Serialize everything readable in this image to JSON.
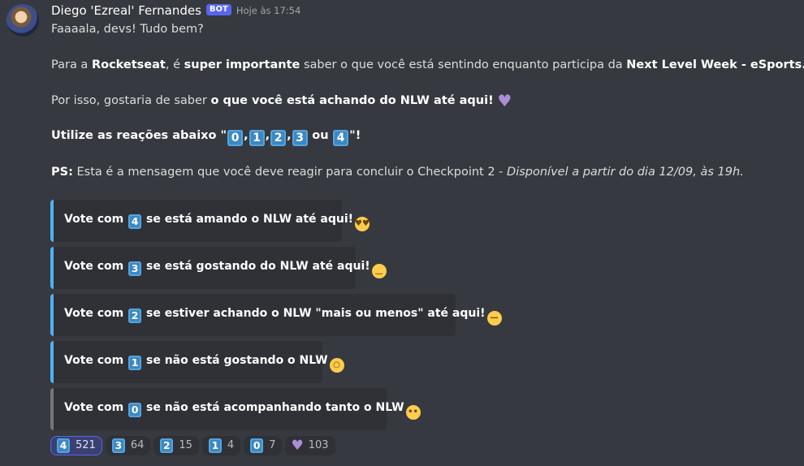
{
  "author": {
    "name": "Diego 'Ezreal' Fernandes",
    "tag": "BOT",
    "timestamp": "Hoje às 17:54"
  },
  "message": {
    "greeting": "Faaaala, devs! Tudo bem?",
    "para2": {
      "a": "Para a ",
      "b1": "Rocketseat",
      "c": ", é ",
      "b2": "super importante",
      "d": " saber o que você está sentindo enquanto participa da ",
      "b3": "Next Level Week - eSports."
    },
    "para3": {
      "a": "Por isso, gostaria de saber ",
      "b": "o que você está achando do NLW até aqui!"
    },
    "para4": {
      "a": "Utilize as reações abaixo \"",
      "k0": "0",
      "k1": "1",
      "k2": "2",
      "k3": "3",
      "k4": "4",
      "sep": ",",
      "ou": "ou",
      "end": "\"!"
    },
    "para5": {
      "ps": "PS:",
      "a": " Esta é a mensagem que você deve reagir para concluir o Checkpoint 2 - ",
      "i": "Disponível a partir do dia 12/09, às 19h."
    }
  },
  "embeds": [
    {
      "pre": "Vote com",
      "key": "4",
      "post": "se está amando o NLW até aqui!",
      "emoji": "heart-eyes-emoji"
    },
    {
      "pre": "Vote com",
      "key": "3",
      "post": "se está gostando do NLW até aqui!",
      "emoji": "grin-emoji"
    },
    {
      "pre": "Vote com",
      "key": "2",
      "post": "se estiver achando o NLW \"mais ou menos\" até aqui!",
      "emoji": "neutral-face-emoji"
    },
    {
      "pre": "Vote com",
      "key": "1",
      "post": "se não está gostando o NLW",
      "emoji": "yawning-face-emoji"
    },
    {
      "pre": "Vote com",
      "key": "0",
      "post": "se não está acompanhando tanto o NLW",
      "emoji": "no-mouth-emoji"
    }
  ],
  "reactions": [
    {
      "key": "4",
      "count": "521",
      "active": true
    },
    {
      "key": "3",
      "count": "64"
    },
    {
      "key": "2",
      "count": "15"
    },
    {
      "key": "1",
      "count": "4"
    },
    {
      "key": "0",
      "count": "7"
    },
    {
      "icon": "purple-heart-icon",
      "count": "103"
    }
  ],
  "colors": {
    "background": "#36393f",
    "embed_background": "#2f3136",
    "embed_accent": "#4fb1f4",
    "bot_tag": "#5865f2",
    "keycap": "#3b88c3"
  }
}
